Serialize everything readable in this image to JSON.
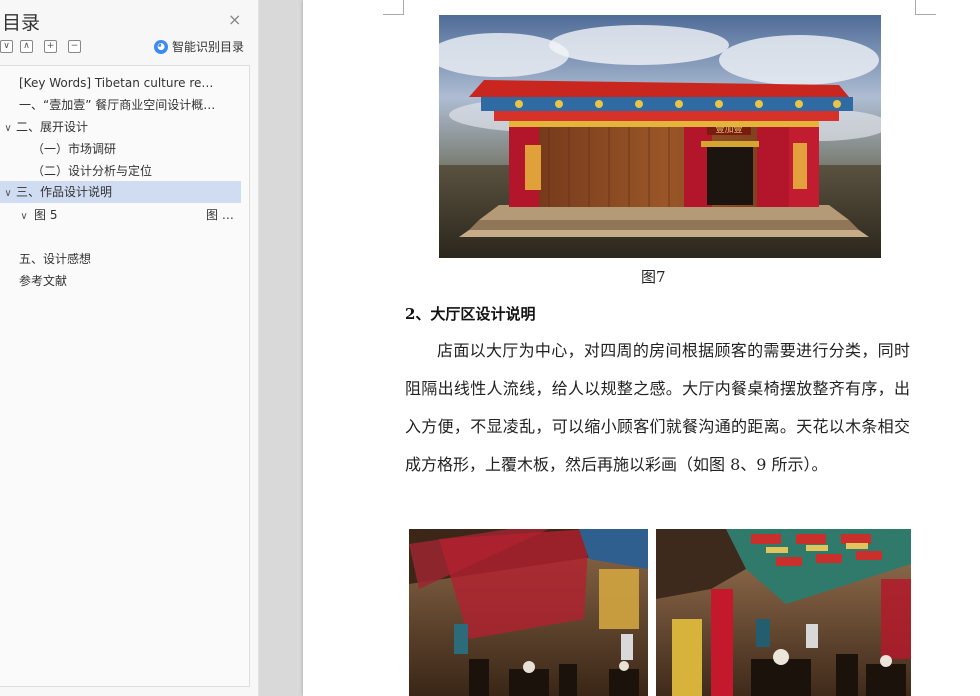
{
  "sidebar": {
    "title": "目录",
    "close_glyph": "×",
    "tools": [
      "∨",
      "∧",
      "+",
      "−"
    ],
    "ai_label": "智能识别目录",
    "items": [
      {
        "label": "[Key Words]   Tibetan culture     re…",
        "chevron": ""
      },
      {
        "label": "一、“壹加壹”  餐厅商业空间设计概…",
        "chevron": ""
      },
      {
        "label": "二、展开设计",
        "chevron": "∨"
      },
      {
        "label": "（一）市场调研",
        "chevron": ""
      },
      {
        "label": "（二）设计分析与定位",
        "chevron": ""
      },
      {
        "label": "三、作品设计说明",
        "chevron": "∨"
      },
      {
        "label": "图 5",
        "chevron": "∨",
        "suffix": "图 …"
      },
      {
        "label": "五、设计感想",
        "chevron": ""
      },
      {
        "label": "参考文献",
        "chevron": ""
      }
    ]
  },
  "document": {
    "caption_7": "图7",
    "heading": "2、大厅区设计说明",
    "paragraph": "店面以大厅为中心，对四周的房间根据顾客的需要进行分类，同时阻隔出线性人流线，给人以规整之感。大厅内餐桌椅摆放整齐有序，出入方便，不显凌乱，可以缩小顾客们就餐沟通的距离。天花以木条相交成方格形，上覆木板，然后再施以彩画（如图 8、9 所示）。",
    "sign_text": "壹加壹"
  }
}
